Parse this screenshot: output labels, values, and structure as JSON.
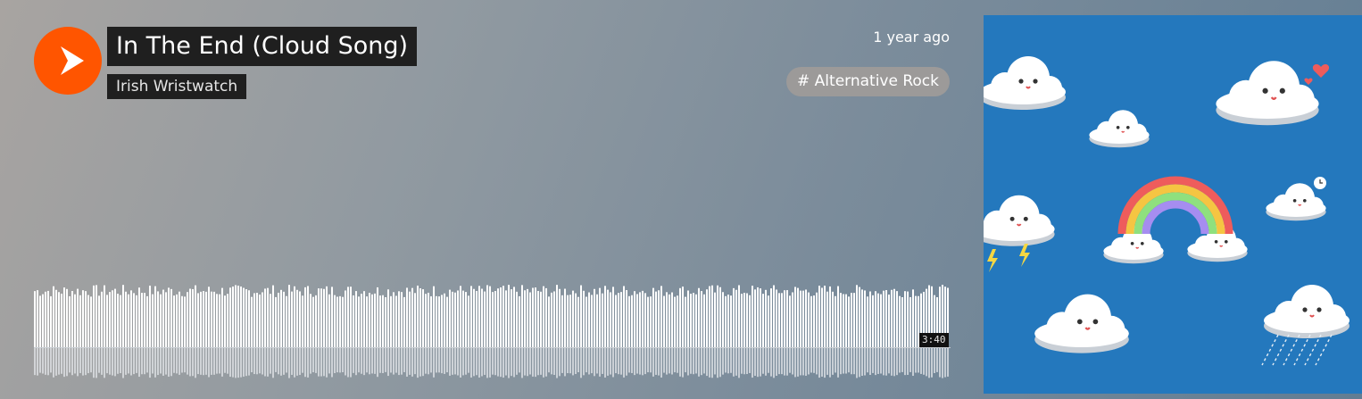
{
  "track": {
    "title": "In The End (Cloud Song)",
    "artist": "Irish Wristwatch",
    "posted": "1 year ago",
    "tag": "# Alternative Rock",
    "duration": "3:40"
  },
  "player": {
    "play_icon": "play-icon",
    "accent": "#ff5500"
  },
  "artwork": {
    "background": "#2478bd",
    "description_icon": "cloud-illustration"
  }
}
